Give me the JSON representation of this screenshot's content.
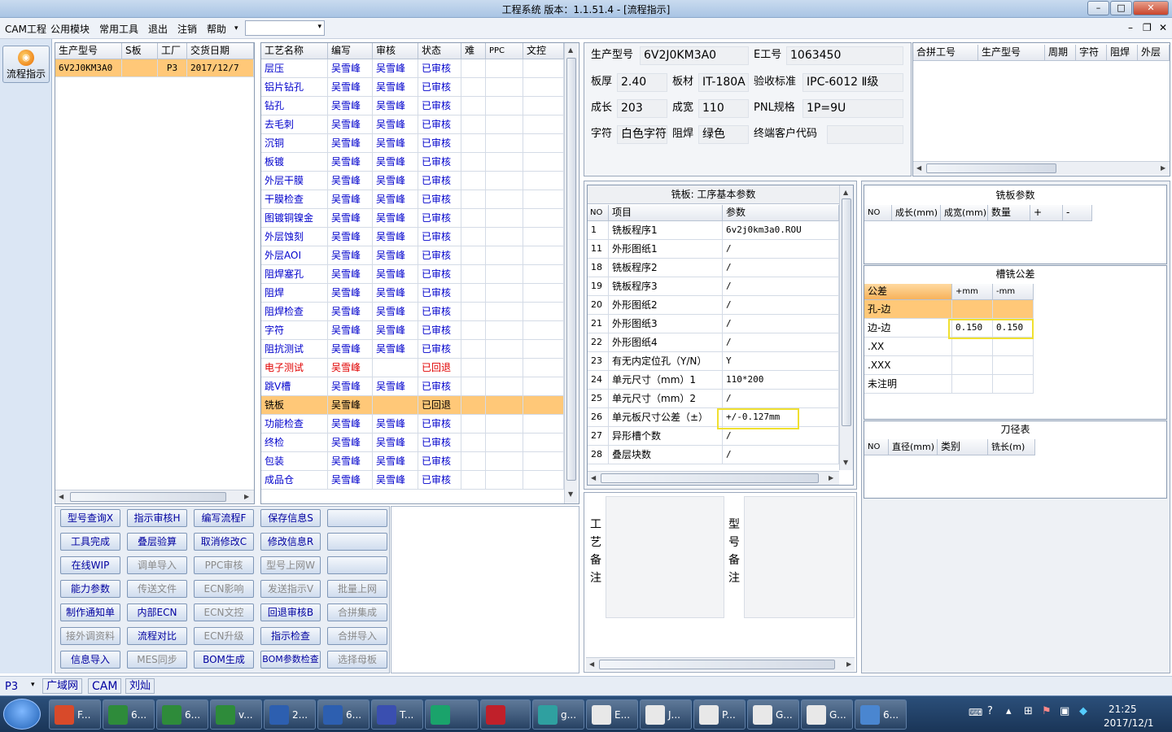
{
  "window": {
    "title": "工程系统   版本：1.1.51.4 - [流程指示]"
  },
  "menu": {
    "items": [
      "CAM工程",
      "公用模块",
      "常用工具",
      "退出",
      "注销",
      "帮助"
    ],
    "combo_value": ""
  },
  "sidebar": {
    "flow_button": "流程指示"
  },
  "model_list": {
    "headers": [
      "生产型号",
      "S板",
      "工厂",
      "交货日期"
    ],
    "rows": [
      [
        "6V2J0KM3A0",
        "",
        "P3",
        "2017/12/7"
      ]
    ]
  },
  "process": {
    "headers": [
      "工艺名称",
      "编写",
      "审核",
      "状态",
      "难",
      "PPC",
      "文控"
    ],
    "rows": [
      [
        "层压",
        "吴雪峰",
        "吴雪峰",
        "已审核",
        "n"
      ],
      [
        "铝片钻孔",
        "吴雪峰",
        "吴雪峰",
        "已审核",
        "n"
      ],
      [
        "钻孔",
        "吴雪峰",
        "吴雪峰",
        "已审核",
        "n"
      ],
      [
        "去毛刺",
        "吴雪峰",
        "吴雪峰",
        "已审核",
        "n"
      ],
      [
        "沉铜",
        "吴雪峰",
        "吴雪峰",
        "已审核",
        "n"
      ],
      [
        "板镀",
        "吴雪峰",
        "吴雪峰",
        "已审核",
        "n"
      ],
      [
        "外层干膜",
        "吴雪峰",
        "吴雪峰",
        "已审核",
        "n"
      ],
      [
        "干膜检查",
        "吴雪峰",
        "吴雪峰",
        "已审核",
        "n"
      ],
      [
        "图镀铜镍金",
        "吴雪峰",
        "吴雪峰",
        "已审核",
        "n"
      ],
      [
        "外层蚀刻",
        "吴雪峰",
        "吴雪峰",
        "已审核",
        "n"
      ],
      [
        "外层AOI",
        "吴雪峰",
        "吴雪峰",
        "已审核",
        "n"
      ],
      [
        "阻焊塞孔",
        "吴雪峰",
        "吴雪峰",
        "已审核",
        "n"
      ],
      [
        "阻焊",
        "吴雪峰",
        "吴雪峰",
        "已审核",
        "n"
      ],
      [
        "阻焊检查",
        "吴雪峰",
        "吴雪峰",
        "已审核",
        "n"
      ],
      [
        "字符",
        "吴雪峰",
        "吴雪峰",
        "已审核",
        "n"
      ],
      [
        "阻抗测试",
        "吴雪峰",
        "吴雪峰",
        "已审核",
        "n"
      ],
      [
        "电子测试",
        "吴雪峰",
        "",
        "已回退",
        "r"
      ],
      [
        "跳V槽",
        "吴雪峰",
        "吴雪峰",
        "已审核",
        "n"
      ],
      [
        "铣板",
        "吴雪峰",
        "",
        "已回退",
        "s"
      ],
      [
        "功能检查",
        "吴雪峰",
        "吴雪峰",
        "已审核",
        "n"
      ],
      [
        "终检",
        "吴雪峰",
        "吴雪峰",
        "已审核",
        "n"
      ],
      [
        "包装",
        "吴雪峰",
        "吴雪峰",
        "已审核",
        "n"
      ],
      [
        "成品仓",
        "吴雪峰",
        "吴雪峰",
        "已审核",
        "n"
      ]
    ]
  },
  "buttons": [
    [
      "型号查询X",
      "指示审核H",
      "编写流程F",
      "保存信息S",
      ""
    ],
    [
      "工具完成",
      "叠层验算",
      "取消修改C",
      "修改信息R",
      ""
    ],
    [
      "在线WIP",
      "调单导入",
      "PPC审核",
      "型号上网W",
      ""
    ],
    [
      "能力参数",
      "传送文件",
      "ECN影响",
      "发送指示V",
      "批量上网"
    ],
    [
      "制作通知单",
      "内部ECN",
      "ECN文控",
      "回退审核B",
      "合拼集成"
    ],
    [
      "接外调资料",
      "流程对比",
      "ECN升级",
      "指示检查",
      "合拼导入"
    ],
    [
      "信息导入",
      "MES同步",
      "BOM生成",
      "BOM参数检查",
      "选择母板"
    ]
  ],
  "buttons_disabled": [
    [
      false,
      false,
      false,
      false,
      false
    ],
    [
      false,
      false,
      false,
      false,
      false
    ],
    [
      false,
      true,
      true,
      true,
      false
    ],
    [
      false,
      true,
      true,
      true,
      true
    ],
    [
      false,
      false,
      true,
      false,
      true
    ],
    [
      true,
      false,
      true,
      false,
      true
    ],
    [
      false,
      true,
      false,
      false,
      true
    ]
  ],
  "info": {
    "model_label": "生产型号",
    "model": "6V2J0KM3A0",
    "eno_label": "E工号",
    "eno": "1063450",
    "thickness_label": "板厚",
    "thickness": "2.40",
    "material_label": "板材",
    "material": "IT-180A",
    "standard_label": "验收标准",
    "standard": "IPC-6012 Ⅱ级",
    "length_label": "成长",
    "length": "203",
    "width_label": "成宽",
    "width": "110",
    "pnl_label": "PNL规格",
    "pnl": "1P=9U",
    "char_label": "字符",
    "char": "白色字符",
    "mask_label": "阻焊",
    "mask": "绿色",
    "cust_label": "终端客户代码",
    "cust": ""
  },
  "merge": {
    "headers": [
      "合拼工号",
      "生产型号",
      "周期",
      "字符",
      "阻焊",
      "外层"
    ]
  },
  "milling": {
    "title": "铣板: 工序基本参数",
    "headers": [
      "NO",
      "项目",
      "参数"
    ],
    "rows": [
      [
        "1",
        "铣板程序1",
        "6v2j0km3a0.ROU"
      ],
      [
        "11",
        "外形图纸1",
        "/"
      ],
      [
        "18",
        "铣板程序2",
        "/"
      ],
      [
        "19",
        "铣板程序3",
        "/"
      ],
      [
        "20",
        "外形图纸2",
        "/"
      ],
      [
        "21",
        "外形图纸3",
        "/"
      ],
      [
        "22",
        "外形图纸4",
        "/"
      ],
      [
        "23",
        "有无内定位孔（Y/N）",
        "Y"
      ],
      [
        "24",
        "单元尺寸（mm）1",
        "110*200"
      ],
      [
        "25",
        "单元尺寸（mm）2",
        "/"
      ],
      [
        "26",
        "单元板尺寸公差（±）",
        "+/-0.127mm"
      ],
      [
        "27",
        "异形槽个数",
        "/"
      ],
      [
        "28",
        "叠层块数",
        "/"
      ]
    ]
  },
  "board_params": {
    "title": "铣板参数",
    "headers": [
      "NO",
      "成长(mm)",
      "成宽(mm)",
      "数量",
      "+",
      "-"
    ]
  },
  "slot_tol": {
    "title": "槽铣公差",
    "headers": [
      "公差",
      "+mm",
      "-mm"
    ],
    "rows": [
      [
        "孔-边",
        "",
        ""
      ],
      [
        "边-边",
        "0.150",
        "0.150"
      ],
      [
        ".XX",
        "",
        ""
      ],
      [
        ".XXX",
        "",
        ""
      ],
      [
        "未注明",
        "",
        ""
      ]
    ]
  },
  "tool_table": {
    "title": "刀径表",
    "headers": [
      "NO",
      "直径(mm)",
      "类别",
      "铣长(m)"
    ]
  },
  "remarks": {
    "process_label": "工艺备注",
    "model_label": "型号备注"
  },
  "status": {
    "factory": "P3",
    "items": [
      "广域网",
      "CAM",
      "刘灿"
    ]
  },
  "taskbar": {
    "items": [
      "F...",
      "6...",
      "6...",
      "v...",
      "2...",
      "6...",
      "T...",
      "",
      "",
      "g...",
      "E...",
      "J...",
      "P...",
      "G...",
      "G...",
      "6..."
    ],
    "time": "21:25",
    "date": "2017/12/1"
  },
  "colors": {
    "highlight": "#f0e030",
    "selected_row": "#ffc878",
    "accent_blue": "#0000cc",
    "returned_red": "#e00000"
  }
}
